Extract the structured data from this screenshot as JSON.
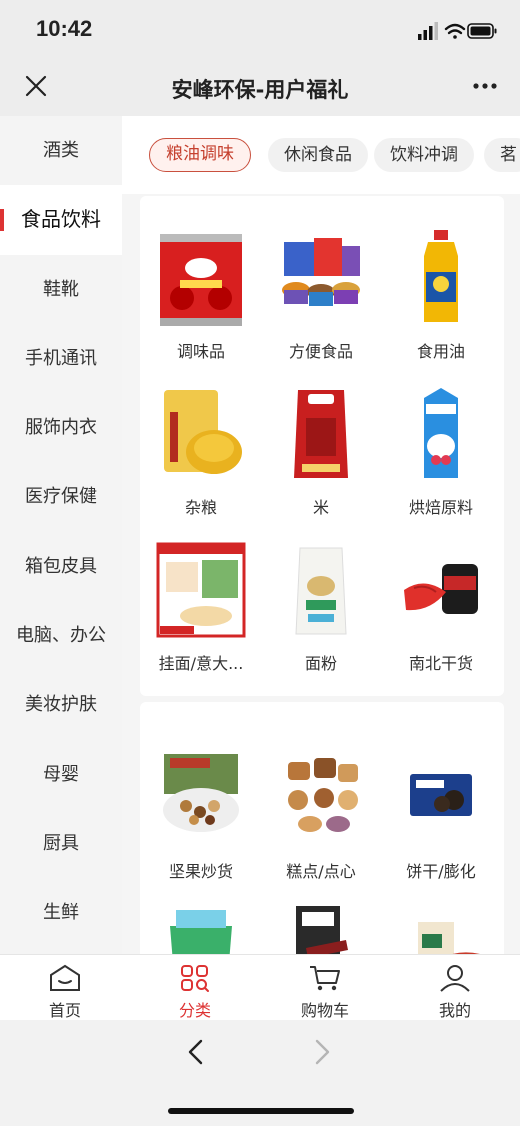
{
  "status": {
    "time": "10:42"
  },
  "header": {
    "title": "安峰环保-用户福礼"
  },
  "sidebar": {
    "items": [
      {
        "label": "酒类"
      },
      {
        "label": "食品饮料"
      },
      {
        "label": "鞋靴"
      },
      {
        "label": "手机通讯"
      },
      {
        "label": "服饰内衣"
      },
      {
        "label": "医疗保健"
      },
      {
        "label": "箱包皮具"
      },
      {
        "label": "电脑、办公"
      },
      {
        "label": "美妆护肤"
      },
      {
        "label": "母婴"
      },
      {
        "label": "厨具"
      },
      {
        "label": "生鲜"
      }
    ],
    "active_index": 1
  },
  "tabs": [
    {
      "label": "粮油调味"
    },
    {
      "label": "休闲食品"
    },
    {
      "label": "饮料冲调"
    },
    {
      "label": "茗"
    }
  ],
  "section1": {
    "items": [
      {
        "label": "调味品",
        "icon": "ketchup-can"
      },
      {
        "label": "方便食品",
        "icon": "instant-noodles"
      },
      {
        "label": "食用油",
        "icon": "cooking-oil-bottle"
      },
      {
        "label": "杂粮",
        "icon": "millet-bag"
      },
      {
        "label": "米",
        "icon": "rice-bag"
      },
      {
        "label": "烘焙原料",
        "icon": "cream-carton"
      },
      {
        "label": "挂面/意大...",
        "icon": "noodles-box"
      },
      {
        "label": "面粉",
        "icon": "flour-bag"
      },
      {
        "label": "南北干货",
        "icon": "dried-goods-jar"
      }
    ]
  },
  "section2": {
    "items": [
      {
        "label": "坚果炒货",
        "icon": "nuts-box"
      },
      {
        "label": "糕点/点心",
        "icon": "pastries"
      },
      {
        "label": "饼干/膨化",
        "icon": "biscuit-pack"
      },
      {
        "label": "",
        "icon": "snack-bucket"
      },
      {
        "label": "",
        "icon": "sausage-pack"
      },
      {
        "label": "",
        "icon": "dried-meat-pack"
      }
    ]
  },
  "tabbar": {
    "items": [
      {
        "label": "首页"
      },
      {
        "label": "分类"
      },
      {
        "label": "购物车"
      },
      {
        "label": "我的"
      }
    ],
    "active_index": 1
  },
  "colors": {
    "accent": "#d33333"
  }
}
